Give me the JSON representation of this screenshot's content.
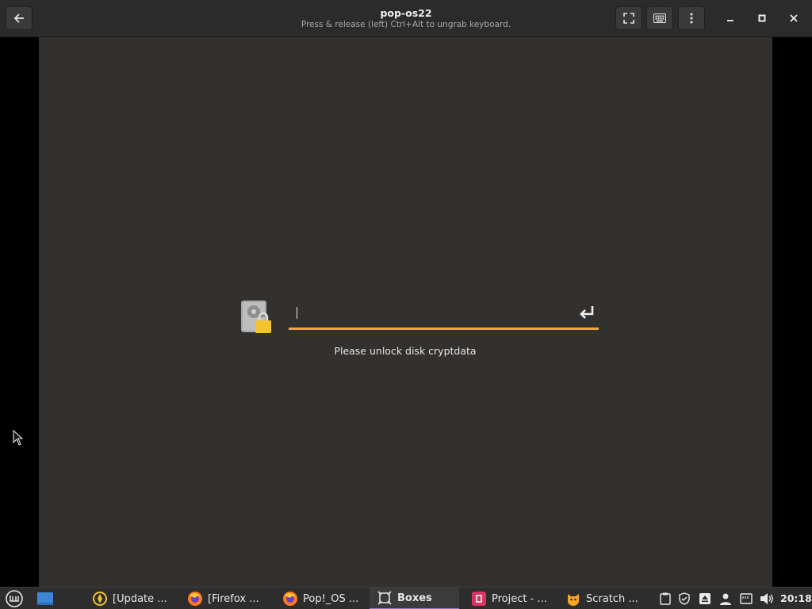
{
  "window": {
    "title": "pop-os22",
    "subtitle": "Press & release (left) Ctrl+Alt to ungrab keyboard."
  },
  "unlock": {
    "password_value": "",
    "message": "Please unlock disk cryptdata",
    "accent_color": "#f0a73a"
  },
  "taskbar": {
    "tasks": [
      {
        "label": "[Update ...",
        "icon": "update-manager-icon"
      },
      {
        "label": "[Firefox ...",
        "icon": "firefox-icon"
      },
      {
        "label": "Pop!_OS ...",
        "icon": "firefox-icon"
      },
      {
        "label": "Boxes",
        "icon": "boxes-icon",
        "active": true
      },
      {
        "label": "Project - ...",
        "icon": "project-icon"
      },
      {
        "label": "Scratch ...",
        "icon": "scratch-icon"
      }
    ],
    "clock": "20:18"
  }
}
